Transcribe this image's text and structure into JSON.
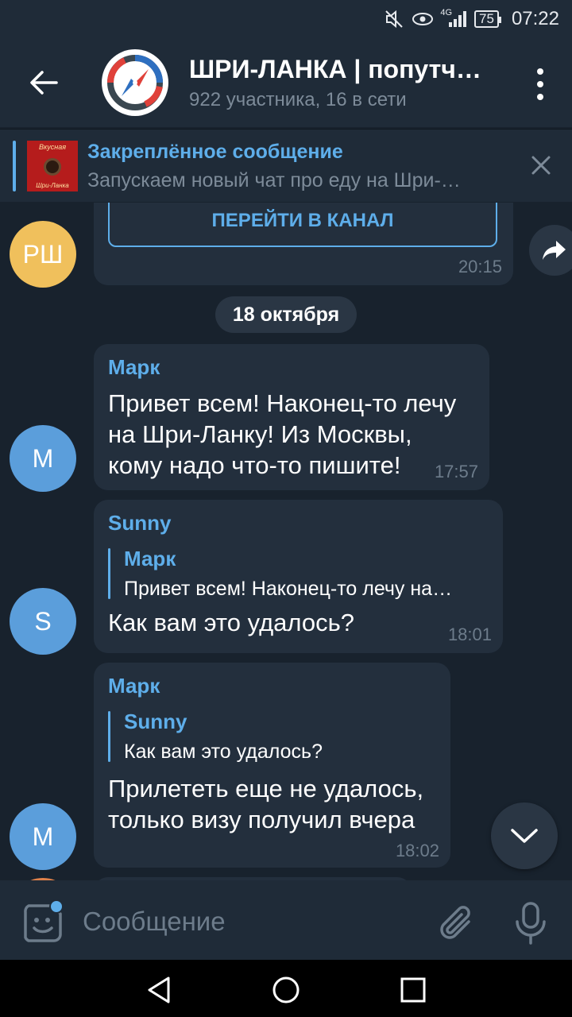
{
  "statusbar": {
    "network": "4G",
    "battery": "75",
    "time": "07:22"
  },
  "header": {
    "title": "ШРИ-ЛАНКА | попутч…",
    "subtitle": "922 участника, 16 в сети"
  },
  "pinned": {
    "title": "Закреплённое сообщение",
    "text": "Запускаем новый чат про еду на Шри-…",
    "thumb_top": "Вкусная",
    "thumb_bottom": "Шри-Ланка"
  },
  "chat": {
    "first_message": {
      "avatar": "РШ",
      "button": "ПЕРЕЙТИ В КАНАЛ",
      "time": "20:15"
    },
    "date": "18 октября",
    "messages": [
      {
        "avatar": "М",
        "name": "Марк",
        "text_lines": [
          "Привет всем! Наконец-то лечу",
          "на Шри-Ланку! Из Москвы,",
          "кому надо что-то пишите!"
        ],
        "time": "17:57"
      },
      {
        "avatar": "S",
        "name": "Sunny",
        "reply_name": "Марк",
        "reply_text": "Привет всем! Наконец-то лечу на…",
        "text": "Как вам это удалось?",
        "time": "18:01"
      },
      {
        "avatar": "М",
        "name": "Марк",
        "reply_name": "Sunny",
        "reply_text": "Как вам это удалось?",
        "text_lines": [
          "Прилететь еще не удалось,",
          "только визу получил вчера"
        ],
        "time": "18:02"
      }
    ]
  },
  "input": {
    "placeholder": "Сообщение"
  },
  "colors": {
    "background": "#18222d",
    "header": "#1f2b38",
    "bubble": "#232f3d",
    "accent": "#5eaeea",
    "avatar_rsh": "#f0c05c",
    "avatar_blue": "#5b9edb"
  },
  "icons": [
    "back-arrow-icon",
    "more-vert-icon",
    "close-icon",
    "share-icon",
    "chevron-down-icon",
    "sticker-icon",
    "paperclip-icon",
    "mic-icon",
    "nav-back-icon",
    "nav-home-icon",
    "nav-recents-icon"
  ]
}
